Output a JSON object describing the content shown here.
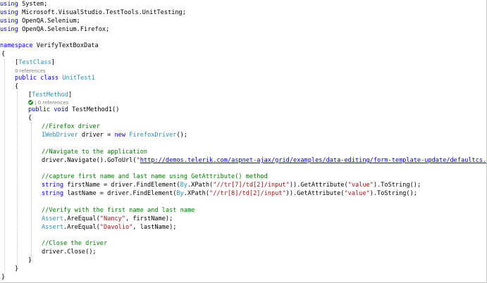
{
  "code": {
    "using_kw": "using",
    "ns_system": "System;",
    "ns_unittesting": "Microsoft.VisualStudio.TestTools.UnitTesting;",
    "ns_selenium": "OpenQA.Selenium;",
    "ns_firefox": "OpenQA.Selenium.Firefox;",
    "namespace_kw": "namespace",
    "namespace_name": "VerifyTextBoxData",
    "open_brace": "{",
    "close_brace": "}",
    "test_class_attr": "TestClass",
    "codelens_class": "0 references",
    "public_kw": "public",
    "class_kw": "class",
    "class_name": "UnitTest1",
    "test_method_attr": "TestMethod",
    "codelens_method_sep": "|",
    "codelens_method": "0 references",
    "void_kw": "void",
    "method_sig": "TestMethod1()",
    "comment_firefox": "//Firefox driver",
    "iwebdriver_type": "IWebDriver",
    "driver_decl": " driver = ",
    "new_kw": "new",
    "firefoxdriver_type": "FirefoxDriver",
    "firefoxdriver_tail": "();",
    "comment_navigate": "//Navigate to the application",
    "navigate_call": "driver.Navigate().GoToUrl(",
    "url_quote_open": "\"",
    "url": "http://demos.telerik.com/aspnet-ajax/grid/examples/data-editing/form-template-update/defaultcs.aspx",
    "url_quote_close": "\"",
    "navigate_tail": ");",
    "comment_capture": "//capture first name and last name using GetAttribute() method",
    "string_kw": "string",
    "firstname_decl": " firstName = driver.FindElement(",
    "by_type": "By",
    "xpath_call": ".XPath(",
    "xpath_first": "\"//tr[7]/td[2]/input\"",
    "getattr_call": ")).GetAttribute(",
    "value_str": "\"value\"",
    "tostring_tail": ").ToString();",
    "lastname_decl": " lastName = driver.FindElement(",
    "xpath_last": "\"//tr[8]/td[2]/input\"",
    "comment_verify": "//Verify with the first name and last name",
    "assert_type": "Assert",
    "areequal_call": ".AreEqual(",
    "nancy_str": "\"Nancy\"",
    "firstname_arg": ", firstName);",
    "davolio_str": "\"Davolio\"",
    "lastname_arg": ", lastName);",
    "comment_close": "//Close the driver",
    "close_call": "driver.Close();"
  }
}
